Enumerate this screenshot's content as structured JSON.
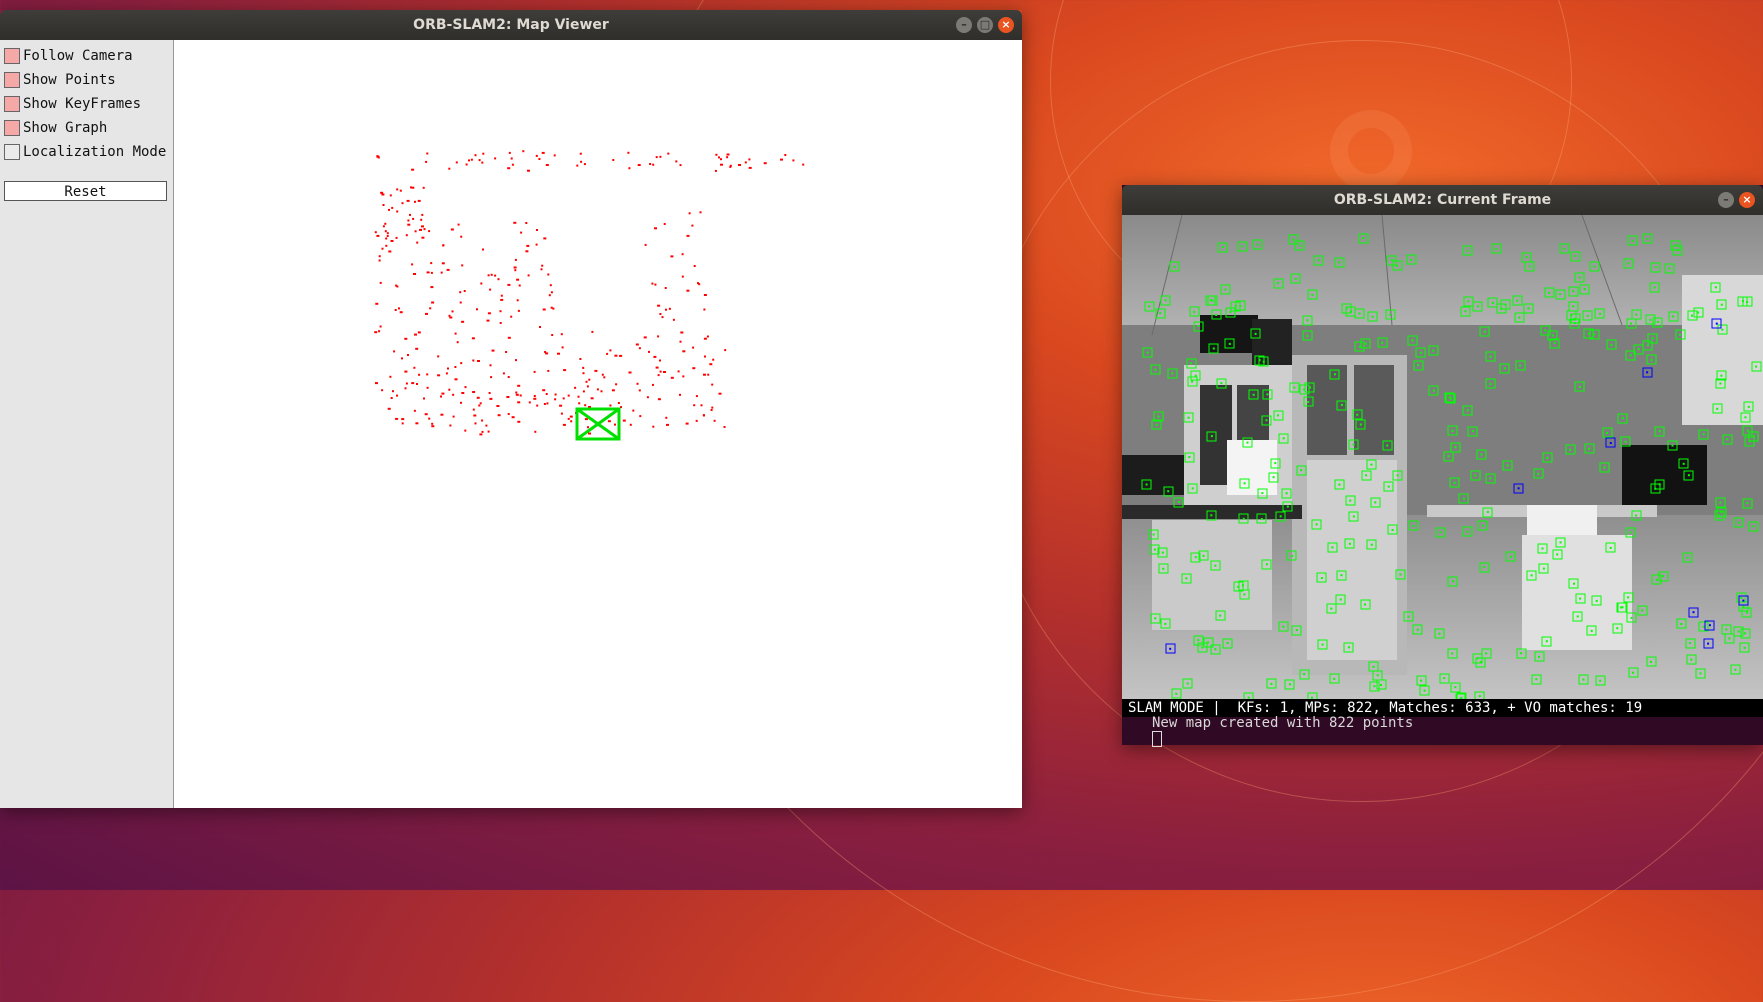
{
  "map_viewer": {
    "title": "ORB-SLAM2: Map Viewer",
    "panel": {
      "items": [
        {
          "label": "Follow Camera",
          "checked": true
        },
        {
          "label": "Show Points",
          "checked": true
        },
        {
          "label": "Show KeyFrames",
          "checked": true
        },
        {
          "label": "Show Graph",
          "checked": true
        },
        {
          "label": "Localization Mode",
          "checked": false
        }
      ],
      "reset_label": "Reset"
    },
    "point_color": "#ff0000",
    "keyframe_color": "#00e000"
  },
  "current_frame": {
    "title": "ORB-SLAM2: Current Frame",
    "status": "SLAM MODE |  KFs: 1, MPs: 822, Matches: 633, + VO matches: 19",
    "feature_color": "#00ff00",
    "vo_color": "#0000ff"
  },
  "terminal": {
    "line": "New map created with 822 points"
  },
  "icons": {
    "minimize": "minimize-icon",
    "maximize": "maximize-icon",
    "close": "close-icon"
  }
}
